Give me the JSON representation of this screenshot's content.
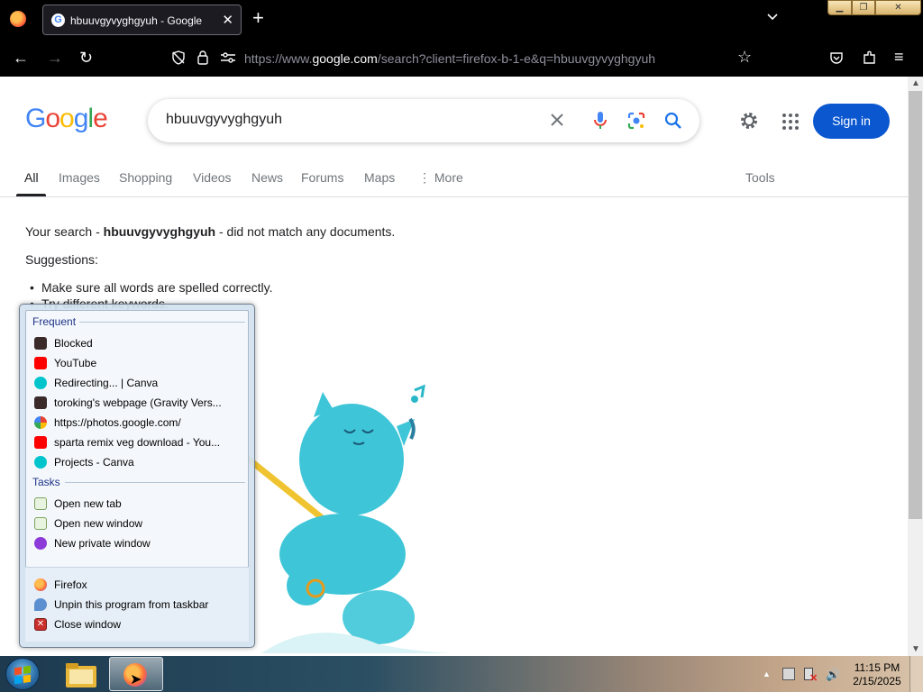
{
  "browser": {
    "tab_title": "hbuuvgyvyghgyuh - Google Search",
    "url_prefix": "https://www.",
    "url_host": "google.com",
    "url_path": "/search?client=firefox-b-1-e&q=hbuuvgyvyghgyuh"
  },
  "google": {
    "logo_letters": [
      "G",
      "o",
      "o",
      "g",
      "l",
      "e"
    ],
    "search_value": "hbuuvgyvyghgyuh",
    "signin_label": "Sign in",
    "tabs": [
      "All",
      "Images",
      "Shopping",
      "Videos",
      "News",
      "Forums",
      "Maps",
      "More"
    ],
    "tools_label": "Tools",
    "nomatch_prefix": "Your search - ",
    "nomatch_query": "hbuuvgyvyghgyuh",
    "nomatch_suffix": " - did not match any documents.",
    "suggestions_title": "Suggestions:",
    "suggestions": [
      "Make sure all words are spelled correctly.",
      "Try different keywords."
    ]
  },
  "jumplist": {
    "frequent_header": "Frequent",
    "frequent": [
      {
        "label": "Blocked",
        "icon": "page-icon"
      },
      {
        "label": "YouTube",
        "icon": "youtube-icon"
      },
      {
        "label": "Redirecting... | Canva",
        "icon": "canva-icon"
      },
      {
        "label": "toroking's webpage (Gravity Vers...",
        "icon": "page-icon"
      },
      {
        "label": "https://photos.google.com/",
        "icon": "google-photos-icon"
      },
      {
        "label": "sparta remix veg download - You...",
        "icon": "youtube-icon"
      },
      {
        "label": "Projects - Canva",
        "icon": "canva-icon"
      }
    ],
    "tasks_header": "Tasks",
    "tasks": [
      {
        "label": "Open new tab",
        "icon": "new-tab-icon"
      },
      {
        "label": "Open new window",
        "icon": "new-window-icon"
      },
      {
        "label": "New private window",
        "icon": "private-window-icon"
      }
    ],
    "program": [
      {
        "label": "Firefox",
        "icon": "firefox-icon"
      },
      {
        "label": "Unpin this program from taskbar",
        "icon": "unpin-icon"
      },
      {
        "label": "Close window",
        "icon": "close-window-icon"
      }
    ]
  },
  "taskbar": {
    "time": "11:15 PM",
    "date": "2/15/2025"
  },
  "colors": {
    "google_blue_button": "#0b57d0",
    "youtube_red": "#ff0000",
    "canva_teal": "#00c4cc",
    "jumplist_header": "#1e3287"
  }
}
